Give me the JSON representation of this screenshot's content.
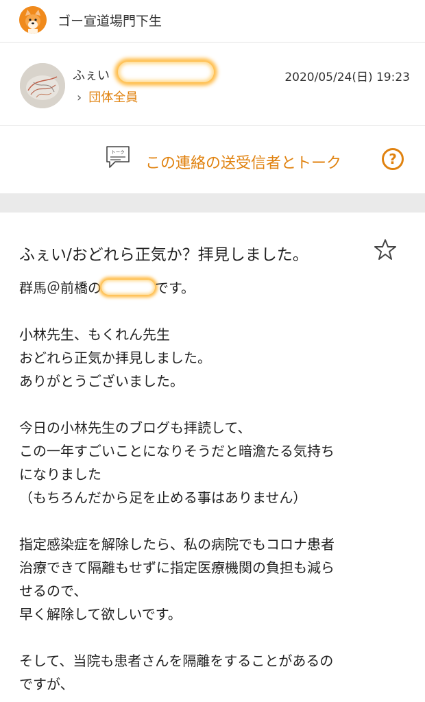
{
  "header": {
    "group_name": "ゴー宣道場門下生"
  },
  "sender": {
    "name_prefix": "ふぇい",
    "recipient": "団体全員",
    "timestamp": "2020/05/24(日) 19:23"
  },
  "talk": {
    "icon_text": "トーク",
    "label": "この連絡の送受信者とトーク"
  },
  "message": {
    "subject": "ふぇい/おどれら正気か？拝見しました。",
    "greeting_before": "群馬＠前橋の",
    "greeting_after": "です。",
    "lines": [
      "",
      "小林先生、もくれん先生",
      "おどれら正気か拝見しました。",
      "ありがとうございました。",
      "",
      "今日の小林先生のブログも拝読して、",
      "この一年すごいことになりそうだと暗澹たる気持ち",
      "になりました",
      "（もちろんだから足を止める事はありません）",
      "",
      "指定感染症を解除したら、私の病院でもコロナ患者",
      "治療できて隔離もせずに指定医療機関の負担も減ら",
      "せるので、",
      "早く解除して欲しいです。",
      "",
      "そして、当院も患者さんを隔離をすることがあるの",
      "ですが、"
    ]
  },
  "colors": {
    "accent": "#e0820f",
    "separator": "#eaeaea"
  },
  "icons": {
    "group": "shiba-dog-icon",
    "talk": "talk-bubble-icon",
    "help": "help-icon",
    "favorite": "star-icon"
  }
}
